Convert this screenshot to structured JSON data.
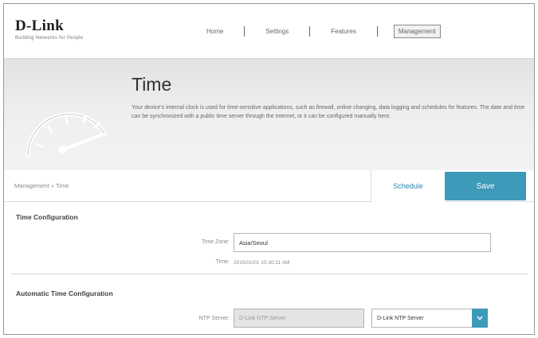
{
  "brand": {
    "name": "D-Link",
    "tagline": "Building Networks for People"
  },
  "nav": {
    "items": [
      {
        "label": "Home"
      },
      {
        "label": "Settings"
      },
      {
        "label": "Features"
      },
      {
        "label": "Management"
      }
    ],
    "active": "Management"
  },
  "hero": {
    "title": "Time",
    "description": "Your device's internal clock is used for time-sensitive applications, such as firewall, online changing, data logging and schedules for features. The date and time can be synchronized with a public time server through the Internet, or it can be configured manually here."
  },
  "breadcrumb": "Management » Time",
  "actions": {
    "schedule_label": "Schedule",
    "save_label": "Save"
  },
  "time_config": {
    "title": "Time Configuration",
    "time_zone_label": "Time Zone:",
    "time_zone_value": "Asia/Seoul",
    "time_label": "Time:",
    "time_value": "2015/01/01 15:30:11 AM"
  },
  "auto_time": {
    "title": "Automatic Time Configuration",
    "ntp_label": "NTP Server:",
    "ntp_placeholder": "D-Link NTP Server",
    "ntp_select_value": "D-Link NTP Server"
  },
  "colors": {
    "accent": "#3e9ab9",
    "link": "#2e87a8"
  },
  "icons": {
    "gauge": "gauge-icon",
    "dropdown": "chevron-down-icon"
  }
}
